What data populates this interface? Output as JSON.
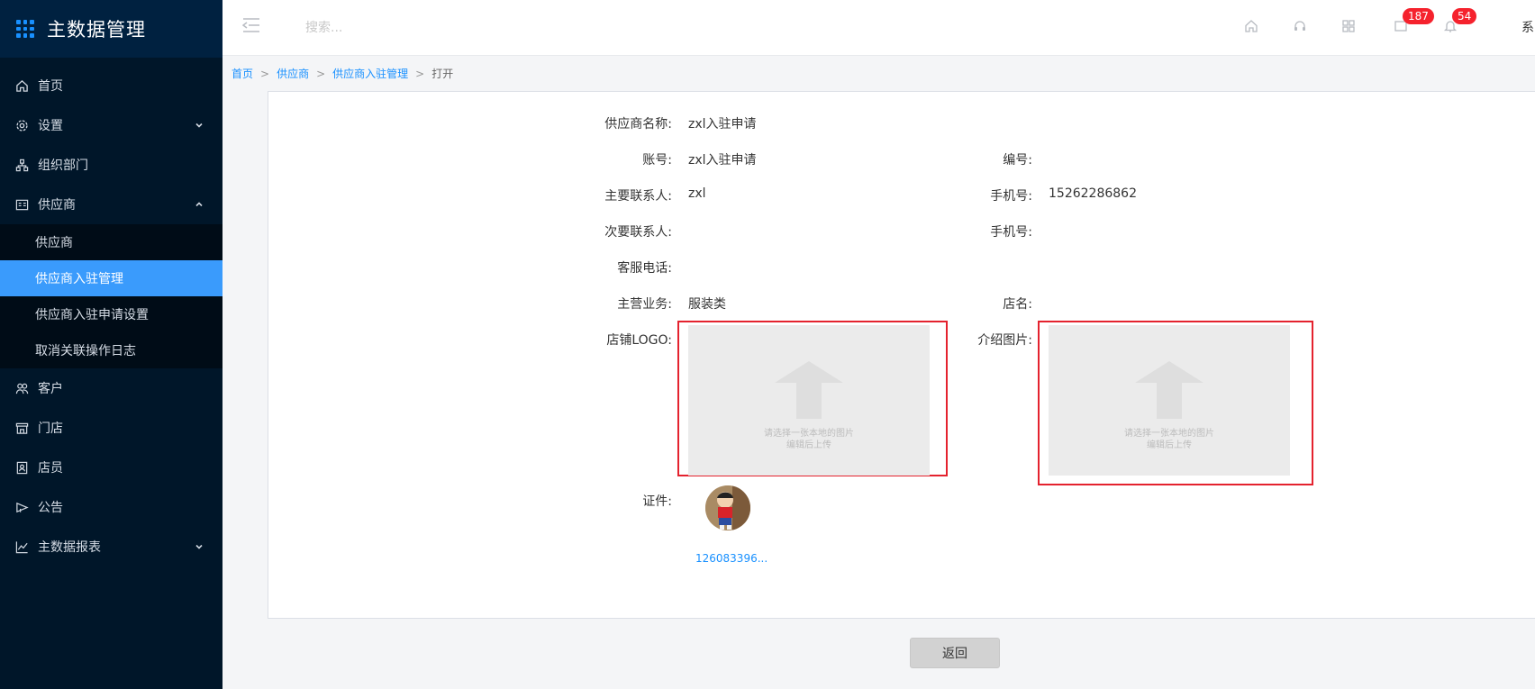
{
  "app": {
    "title": "主数据管理"
  },
  "sidebar": {
    "items": [
      {
        "label": "首页",
        "icon": "home-icon"
      },
      {
        "label": "设置",
        "icon": "gear-icon"
      },
      {
        "label": "组织部门",
        "icon": "org-icon"
      },
      {
        "label": "供应商",
        "icon": "supplier-icon"
      },
      {
        "label": "客户",
        "icon": "customer-icon"
      },
      {
        "label": "门店",
        "icon": "store-icon"
      },
      {
        "label": "店员",
        "icon": "clerk-icon"
      },
      {
        "label": "公告",
        "icon": "announcement-icon"
      },
      {
        "label": "主数据报表",
        "icon": "chart-icon"
      }
    ],
    "submenu": [
      {
        "label": "供应商"
      },
      {
        "label": "供应商入驻管理",
        "active": true
      },
      {
        "label": "供应商入驻申请设置"
      },
      {
        "label": "取消关联操作日志"
      }
    ]
  },
  "header": {
    "search_placeholder": "搜索...",
    "badge_messages": "187",
    "badge_notifications": "54",
    "user": "系"
  },
  "breadcrumb": {
    "home": "首页",
    "level1": "供应商",
    "level2": "供应商入驻管理",
    "current": "打开",
    "sep": ">"
  },
  "form": {
    "supplier_name_label": "供应商名称:",
    "supplier_name": "zxl入驻申请",
    "account_label": "账号:",
    "account": "zxl入驻申请",
    "code_label": "编号:",
    "code": "",
    "main_contact_label": "主要联系人:",
    "main_contact": "zxl",
    "phone_label": "手机号:",
    "phone": "15262286862",
    "secondary_contact_label": "次要联系人:",
    "secondary_contact": "",
    "phone2_label": "手机号:",
    "phone2": "",
    "service_phone_label": "客服电话:",
    "service_phone": "",
    "business_label": "主营业务:",
    "business": "服装类",
    "shop_name_label": "店名:",
    "shop_name": "",
    "logo_label": "店铺LOGO:",
    "intro_label": "介绍图片:",
    "upload_hint_line1": "请选择一张本地的图片",
    "upload_hint_line2": "编辑后上传",
    "certificate_label": "证件:",
    "certificate_file": "126083396..."
  },
  "actions": {
    "back": "返回"
  },
  "colors": {
    "sidebar_bg": "#001629",
    "active": "#3a9bfc",
    "link": "#1890ff",
    "highlight_border": "#e4222e",
    "badge": "#f5222d"
  }
}
